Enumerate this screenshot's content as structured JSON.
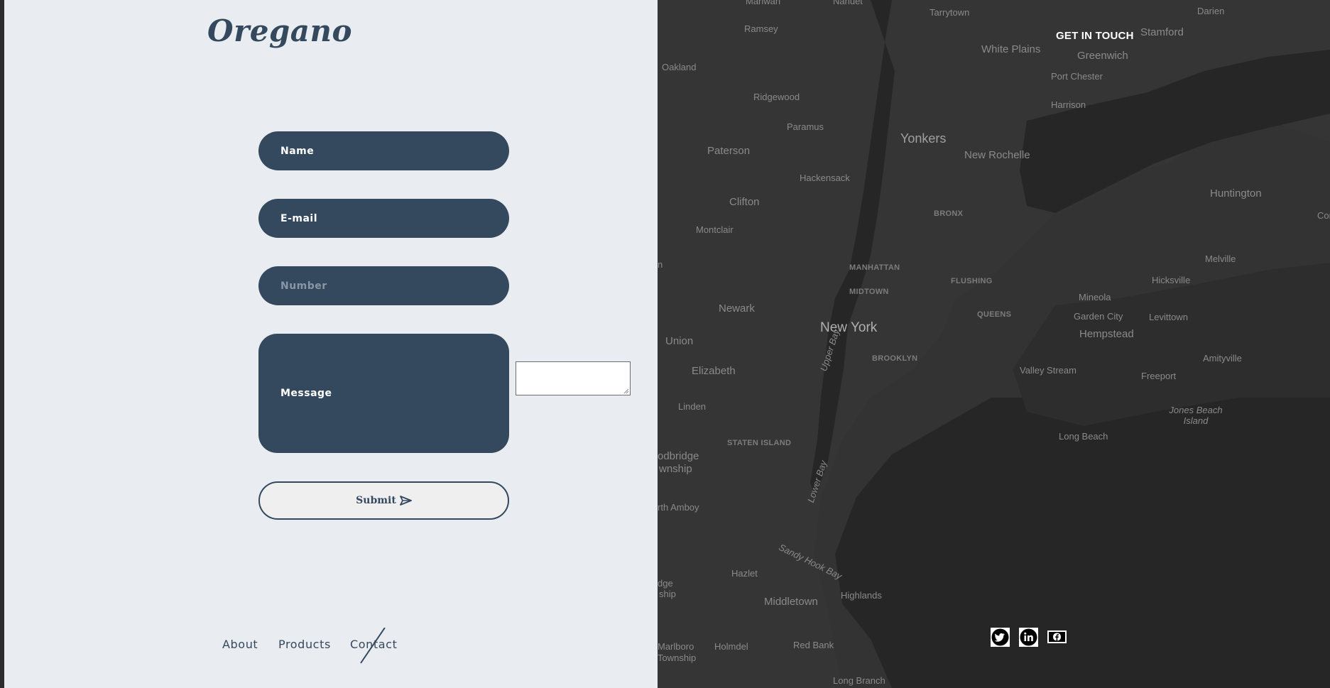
{
  "brand": {
    "logo_text": "Oregano"
  },
  "form": {
    "name_label": "Name",
    "email_label": "E-mail",
    "number_placeholder": "Number",
    "message_label": "Message",
    "submit_label": "Submit"
  },
  "footer_nav": [
    {
      "label": "About"
    },
    {
      "label": "Products"
    },
    {
      "label": "Contact"
    }
  ],
  "header": {
    "get_in_touch": "GET IN TOUCH"
  },
  "social": [
    "twitter-icon",
    "linkedin-icon",
    "facebook-icon"
  ],
  "colors": {
    "brand": "#34495e",
    "left_bg": "#e9edf1",
    "map_bg": "#2b2b2b"
  },
  "map": {
    "labels": [
      "Marlwah",
      "Nanuet",
      "Tarrytown",
      "Darien",
      "Ramsey",
      "White Plains",
      "Stamford",
      "Greenwich",
      "Oakland",
      "Port Chester",
      "Ridgewood",
      "Harrison",
      "Paramus",
      "Yonkers",
      "Paterson",
      "New Rochelle",
      "Hackensack",
      "Clifton",
      "BRONX",
      "Huntington",
      "Montclair",
      "Com",
      "Melville",
      "MANHATTAN",
      "FLUSHING",
      "Hicksville",
      "MIDTOWN",
      "Mineola",
      "Newark",
      "QUEENS",
      "Garden City",
      "Levittown",
      "New York",
      "Hempstead",
      "Union",
      "Upper Bay",
      "BROOKLYN",
      "Amityville",
      "Elizabeth",
      "Valley Stream",
      "Freeport",
      "Linden",
      "Jones Beach Island",
      "Long Beach",
      "STATEN ISLAND",
      "odbridge",
      "wnship",
      "Lower Bay",
      "rth Amboy",
      "Sandy Hook Bay",
      "Hazlet",
      "dge",
      "ship",
      "Middletown",
      "Highlands",
      "Marlboro",
      "Township",
      "Holmdel",
      "Red Bank",
      "Long Branch",
      "n"
    ]
  }
}
